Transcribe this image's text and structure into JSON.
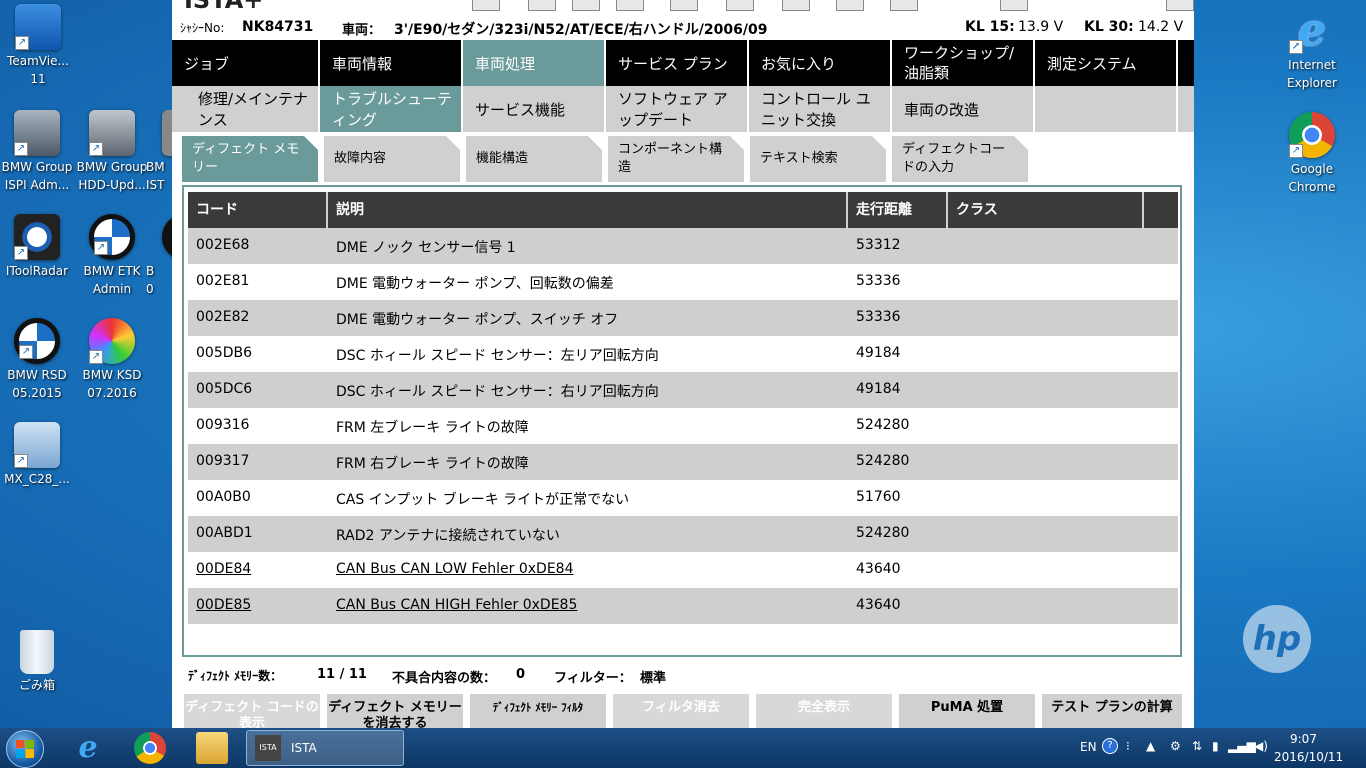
{
  "desktop": {
    "icons_left": [
      {
        "label1": "TeamVie...",
        "label2": "11",
        "icon": "teamviewer-icon"
      },
      {
        "label1": "BMW Group",
        "label2": "ISPI Adm...",
        "icon": "ispi-admin-icon"
      },
      {
        "label1": "BMW Group",
        "label2": "HDD-Upd...",
        "icon": "hdd-update-icon"
      },
      {
        "label1": "BM",
        "label2": "IST",
        "icon": "ista-icon"
      },
      {
        "label1": "IToolRadar",
        "label2": "",
        "icon": "itoolradar-icon"
      },
      {
        "label1": "BMW ETK",
        "label2": "Admin",
        "icon": "bmw-etk-icon"
      },
      {
        "label1": "B",
        "label2": "0",
        "icon": "bmw-icon"
      },
      {
        "label1": "BMW RSD",
        "label2": "05.2015",
        "icon": "bmw-rsd-icon"
      },
      {
        "label1": "BMW KSD",
        "label2": "07.2016",
        "icon": "bmw-ksd-icon"
      },
      {
        "label1": "MX_C28_...",
        "label2": "",
        "icon": "mx-c28-icon"
      },
      {
        "label1": "ごみ箱",
        "label2": "",
        "icon": "recycle-bin-icon"
      }
    ],
    "icons_right": [
      {
        "label1": "Internet",
        "label2": "Explorer",
        "icon": "internet-explorer-icon"
      },
      {
        "label1": "Google",
        "label2": "Chrome",
        "icon": "chrome-icon"
      }
    ],
    "brand_logo": "hp"
  },
  "app": {
    "title": "ISTA+",
    "vehicle_info": {
      "chassis_label": "ｼｬｼｰNo:",
      "chassis_value": "NK84731",
      "vehicle_label": "車両：",
      "vehicle_value": "3'/E90/セダン/323i/N52/AT/ECE/右ハンドル/2006/09",
      "kl15_label": "KL 15:",
      "kl15_value": "13.9 V",
      "kl30_label": "KL 30:",
      "kl30_value": "14.2 V"
    },
    "main_menu": [
      "ジョブ",
      "車両情報",
      "車両処理",
      "サービス プラン",
      "お気に入り",
      "ワークショップ/ 油脂類",
      "測定システム"
    ],
    "sub_menu": [
      "修理/メインテナンス",
      "トラブルシューティング",
      "サービス機能",
      "ソフトウェア アップデート",
      "コントロール ユニット交換",
      "車両の改造",
      ""
    ],
    "tabs": [
      "ディフェクト メモリー",
      "故障内容",
      "機能構造",
      "コンポーネント構造",
      "テキスト検索",
      "ディフェクトコードの入力"
    ],
    "table": {
      "headers": [
        "コード",
        "説明",
        "走行距離",
        "クラス"
      ],
      "rows": [
        {
          "code": "002E68",
          "desc": "DME ノック センサー信号 1",
          "mileage": "53312",
          "class": ""
        },
        {
          "code": "002E81",
          "desc": "DME 電動ウォーター ポンプ、回転数の偏差",
          "mileage": "53336",
          "class": ""
        },
        {
          "code": "002E82",
          "desc": "DME 電動ウォーター ポンプ、スイッチ オフ",
          "mileage": "53336",
          "class": ""
        },
        {
          "code": "005DB6",
          "desc": "DSC ホィール スピード センサー：左リア回転方向",
          "mileage": "49184",
          "class": ""
        },
        {
          "code": "005DC6",
          "desc": "DSC ホィール スピード センサー：右リア回転方向",
          "mileage": "49184",
          "class": ""
        },
        {
          "code": "009316",
          "desc": "FRM 左ブレーキ ライトの故障",
          "mileage": "524280",
          "class": ""
        },
        {
          "code": "009317",
          "desc": "FRM 右ブレーキ ライトの故障",
          "mileage": "524280",
          "class": ""
        },
        {
          "code": "00A0B0",
          "desc": "CAS インプット ブレーキ ライトが正常でない",
          "mileage": "51760",
          "class": ""
        },
        {
          "code": "00ABD1",
          "desc": "RAD2 アンテナに接続されていない",
          "mileage": "524280",
          "class": ""
        },
        {
          "code": "00DE84",
          "desc": "CAN Bus CAN LOW Fehler 0xDE84",
          "mileage": "43640",
          "class": ""
        },
        {
          "code": "00DE85",
          "desc": "CAN Bus CAN HIGH Fehler 0xDE85",
          "mileage": "43640",
          "class": ""
        }
      ]
    },
    "status": {
      "count_label": "ﾃﾞｨﾌｪｸﾄ ﾒﾓﾘｰ数：",
      "count_value": "11 / 11",
      "nonconform_label": "不具合内容の数：",
      "nonconform_value": "0",
      "filter_label": "フィルター：",
      "filter_value": "標準"
    },
    "buttons": [
      "ディフェクト コードの表示",
      "ディフェクト メモリーを消去する",
      "ﾃﾞｨﾌｪｸﾄ ﾒﾓﾘｰ ﾌｨﾙﾀ",
      "フィルタ消去",
      "完全表示",
      "PuMA 処置",
      "テスト プランの計算"
    ]
  },
  "taskbar": {
    "task_label": "ISTA",
    "task_icon_text": "ISTA",
    "lang": "EN",
    "time": "9:07",
    "date": "2016/10/11"
  },
  "colors": {
    "accent": "#6b9a9a",
    "menubar": "#000000",
    "row_alt": "#cfcfcf",
    "header": "#3a3a3a"
  }
}
